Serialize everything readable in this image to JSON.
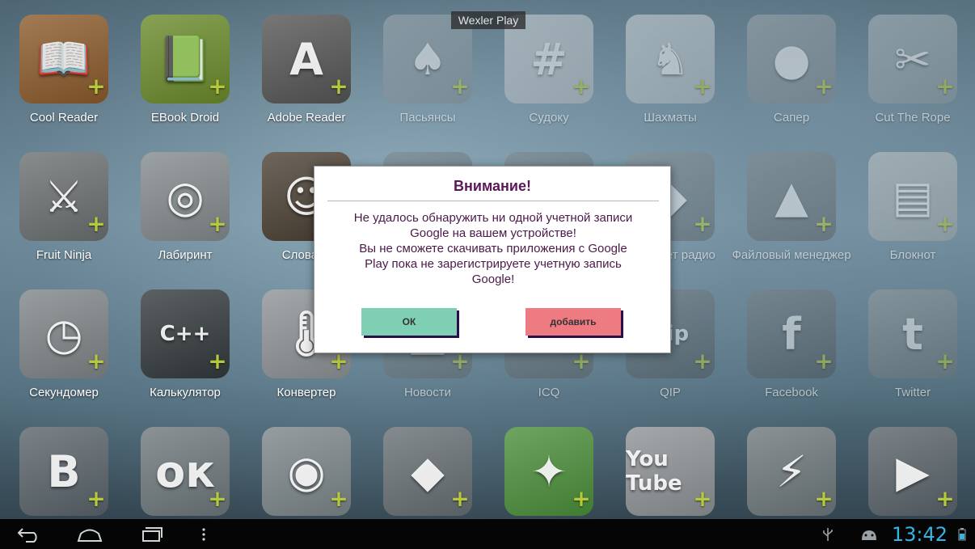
{
  "window_title": "Wexler Play",
  "apps": [
    {
      "label": "Cool Reader",
      "icon": "book-icon",
      "glyph": "📖",
      "color": "#8a5a2b"
    },
    {
      "label": "EBook Droid",
      "icon": "ebook-icon",
      "glyph": "📗",
      "color": "#6a8a2b"
    },
    {
      "label": "Adobe Reader",
      "icon": "pdf-icon",
      "glyph": "A",
      "color": "#555555"
    },
    {
      "label": "Пасьянсы",
      "icon": "cards-icon",
      "glyph": "♠",
      "color": "#8c9aa2"
    },
    {
      "label": "Судоку",
      "icon": "sudoku-icon",
      "glyph": "#",
      "color": "#c9ced2"
    },
    {
      "label": "Шахматы",
      "icon": "chess-icon",
      "glyph": "♞",
      "color": "#c7cfd3"
    },
    {
      "label": "Сапер",
      "icon": "mine-icon",
      "glyph": "●",
      "color": "#8a949a"
    },
    {
      "label": "Cut The Rope",
      "icon": "candy-icon",
      "glyph": "✂",
      "color": "#9aa8ae"
    },
    {
      "label": "Fruit Ninja",
      "icon": "fruit-icon",
      "glyph": "⚔",
      "color": "#6a6f70"
    },
    {
      "label": "Лабиринт",
      "icon": "labyrinth-icon",
      "glyph": "◎",
      "color": "#838a8c"
    },
    {
      "label": "Словарь",
      "icon": "dictionary-icon",
      "glyph": "☺",
      "color": "#4a3f33"
    },
    {
      "label": "",
      "icon": "hidden-icon",
      "glyph": "",
      "color": "#5f6a70"
    },
    {
      "label": "",
      "icon": "hidden-icon",
      "glyph": "",
      "color": "#5f6a70"
    },
    {
      "label": "Интернет радио",
      "icon": "radio-icon",
      "glyph": "◆",
      "color": "#6d777b"
    },
    {
      "label": "Файловый менеджер",
      "icon": "folder-icon",
      "glyph": "▲",
      "color": "#6a7276"
    },
    {
      "label": "Блокнот",
      "icon": "notepad-icon",
      "glyph": "▤",
      "color": "#b5babb"
    },
    {
      "label": "Секундомер",
      "icon": "stopwatch-icon",
      "glyph": "◷",
      "color": "#7e8487"
    },
    {
      "label": "Калькулятор",
      "icon": "calculator-icon",
      "glyph": "C++",
      "color": "#33393c"
    },
    {
      "label": "Конвертер",
      "icon": "thermometer-icon",
      "glyph": "🌡",
      "color": "#8d9295"
    },
    {
      "label": "Новости",
      "icon": "news-icon",
      "glyph": "▦",
      "color": "#6d777b"
    },
    {
      "label": "ICQ",
      "icon": "icq-icon",
      "glyph": "✿",
      "color": "#666e72"
    },
    {
      "label": "QIP",
      "icon": "qip-icon",
      "glyph": "qip",
      "color": "#59636a"
    },
    {
      "label": "Facebook",
      "icon": "facebook-icon",
      "glyph": "f",
      "color": "#59636a"
    },
    {
      "label": "Twitter",
      "icon": "twitter-icon",
      "glyph": "t",
      "color": "#7b8589"
    },
    {
      "label": "",
      "icon": "vk-icon",
      "glyph": "B",
      "color": "#59636a"
    },
    {
      "label": "",
      "icon": "odnoklassniki-icon",
      "glyph": "ок",
      "color": "#6d777b"
    },
    {
      "label": "",
      "icon": "browser-icon",
      "glyph": "◉",
      "color": "#7b8589"
    },
    {
      "label": "",
      "icon": "maps-icon",
      "glyph": "◆",
      "color": "#666e72"
    },
    {
      "label": "",
      "icon": "navigation-icon",
      "glyph": "✦",
      "color": "#4a8e3a"
    },
    {
      "label": "",
      "icon": "youtube-icon",
      "glyph": "You Tube",
      "color": "#8d9295"
    },
    {
      "label": "",
      "icon": "winamp-icon",
      "glyph": "⚡",
      "color": "#6d777b"
    },
    {
      "label": "",
      "icon": "player-icon",
      "glyph": "▶",
      "color": "#59636a"
    }
  ],
  "dialog": {
    "title": "Внимание!",
    "message_lines": [
      "Не удалось обнаружить ни одной учетной записи",
      "Google на вашем устройстве!",
      "Вы не сможете скачивать приложения с Google",
      "Play пока не зарегистрируете учетную запись",
      "Google!"
    ],
    "ok_label": "ОК",
    "add_label": "добавить"
  },
  "navbar": {
    "clock": "13:42"
  },
  "colors": {
    "accent_clock": "#33b5e5",
    "ok_button": "#7fcfb5",
    "add_button": "#ee7b82",
    "plus_badge": "#b6c93a"
  }
}
